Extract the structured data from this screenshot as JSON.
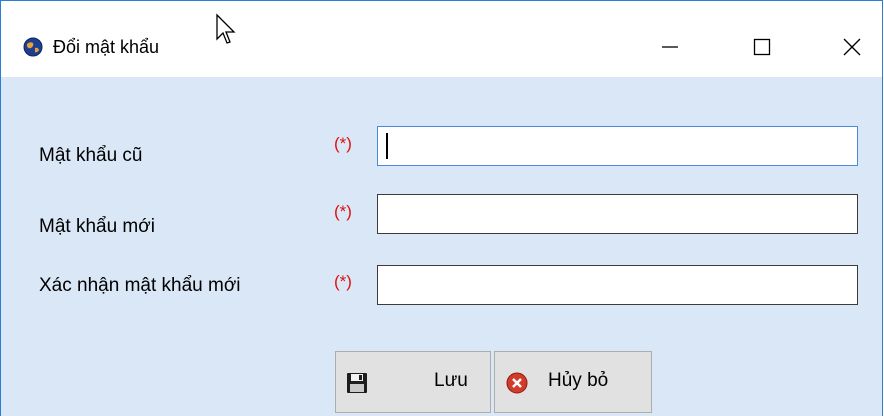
{
  "window": {
    "title": "Đổi mật khẩu",
    "icon": "globe-app-icon",
    "controls": [
      "minimize-icon",
      "maximize-icon",
      "close-icon"
    ]
  },
  "form": {
    "required_marker": "(*)",
    "fields": [
      {
        "label": "Mật khẩu cũ",
        "value": "",
        "focused": true
      },
      {
        "label": "Mật khẩu mới",
        "value": ""
      },
      {
        "label": "Xác nhận mật khẩu mới",
        "value": ""
      }
    ]
  },
  "buttons": {
    "save_label": "Lưu",
    "save_icon": "floppy-disk-icon",
    "cancel_label": "Hủy bỏ",
    "cancel_icon": "red-x-circle-icon"
  },
  "colors": {
    "window_bg": "#d9e7f6",
    "required": "#e01010",
    "border_accent": "#2a7fd3"
  }
}
